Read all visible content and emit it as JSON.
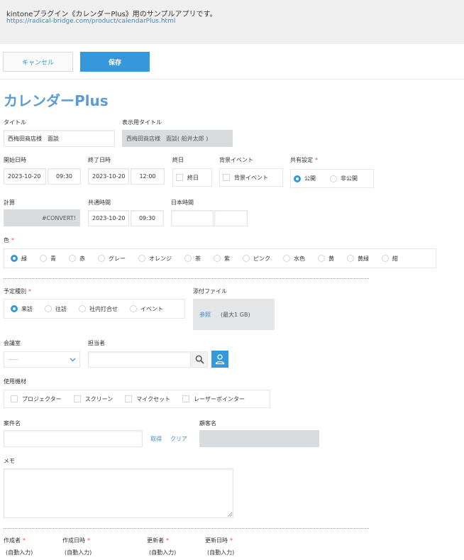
{
  "notice": {
    "text": "kintoneプラグイン《カレンダーPlus》用のサンプルアプリです。",
    "link": "https://radical-bridge.com/product/calendarPlus.html"
  },
  "toolbar": {
    "cancel_label": "キャンセル",
    "save_label": "保存"
  },
  "app_title": "カレンダーPlus",
  "fields": {
    "title": {
      "label": "タイトル",
      "value": "西梅田商店様　面談"
    },
    "display_title": {
      "label": "表示用タイトル",
      "value": "西梅田商店様　面談( 船井太郎 )"
    },
    "start": {
      "label": "開始日時",
      "date": "2023-10-20",
      "time": "09:30"
    },
    "end": {
      "label": "終了日時",
      "date": "2023-10-20",
      "time": "12:00"
    },
    "allday": {
      "label": "終日",
      "option": "終日"
    },
    "bg_event": {
      "label": "背景イベント",
      "option": "背景イベント"
    },
    "share": {
      "label": "共有設定",
      "required": "*",
      "options": [
        "公開",
        "非公開"
      ],
      "selected": "公開"
    },
    "calc": {
      "label": "計算",
      "value": "#CONVERT!"
    },
    "common_time": {
      "label": "共通時間",
      "date": "2023-10-20",
      "time": "09:30"
    },
    "japan_time": {
      "label": "日本時間",
      "date": "",
      "time": ""
    },
    "color": {
      "label": "色",
      "required": "*",
      "options": [
        "緑",
        "青",
        "赤",
        "グレー",
        "オレンジ",
        "茶",
        "紫",
        "ピンク",
        "水色",
        "黄",
        "黄緑",
        "紺"
      ],
      "selected": "緑"
    },
    "schedule_type": {
      "label": "予定種別",
      "required": "*",
      "options": [
        "来訪",
        "往訪",
        "社内打合せ",
        "イベント"
      ],
      "selected": "来訪"
    },
    "attachment": {
      "label": "添付ファイル",
      "browse": "参照",
      "limit": "(最大1 GB)"
    },
    "room": {
      "label": "会議室",
      "value": "-----"
    },
    "assignee": {
      "label": "担当者",
      "value": ""
    },
    "equipment": {
      "label": "使用機材",
      "options": [
        "プロジェクター",
        "スクリーン",
        "マイクセット",
        "レーザーポインター"
      ]
    },
    "case_name": {
      "label": "案件名",
      "value": "",
      "fetch": "取得",
      "clear": "クリア"
    },
    "customer": {
      "label": "顧客名",
      "value": ""
    },
    "memo": {
      "label": "メモ",
      "value": ""
    },
    "creator": {
      "label": "作成者",
      "required": "*",
      "value": "(自動入力)"
    },
    "created_at": {
      "label": "作成日時",
      "required": "*",
      "value": "(自動入力)"
    },
    "updater": {
      "label": "更新者",
      "required": "*",
      "value": "(自動入力)"
    },
    "updated_at": {
      "label": "更新日時",
      "required": "*",
      "value": "(自動入力)"
    }
  },
  "colors": {
    "accent": "#3498db",
    "title": "#5d9bd5",
    "required": "#e74c3c",
    "readonly": "#d8dcde"
  }
}
